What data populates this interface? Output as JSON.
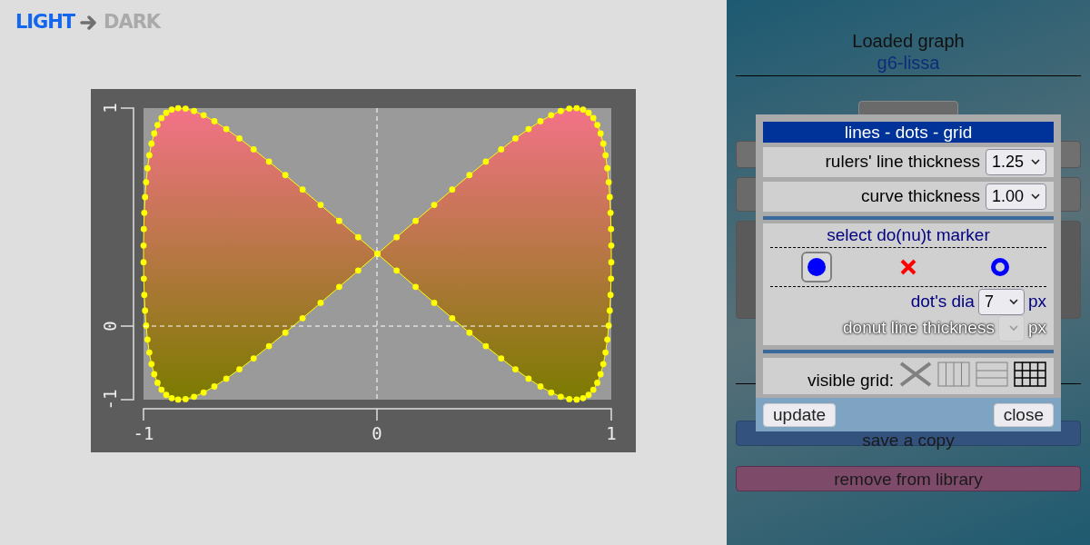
{
  "mode_switch": [
    {
      "label": "LIGHT",
      "selected": true
    },
    {
      "label": "DARK",
      "selected": false
    }
  ],
  "plot": {
    "y_ticks": [
      "1",
      "0",
      "-1"
    ],
    "x_ticks": [
      "-1",
      "0",
      "1"
    ]
  },
  "side_panel": {
    "heading": "Loaded graph",
    "graph_name": "g6-lissa",
    "save_button": "save a copy",
    "remove_button": "remove from library"
  },
  "dialog": {
    "title": "lines - dots - grid",
    "rows": [
      {
        "label": "rulers' line thickness",
        "value": "1.25"
      },
      {
        "label": "curve thickness",
        "value": "1.00"
      }
    ],
    "marker": {
      "title": "select do(nu)t marker",
      "options": [
        {
          "kind": "dot",
          "selected": true
        },
        {
          "kind": "cross",
          "selected": false
        },
        {
          "kind": "donut",
          "selected": false
        }
      ],
      "dia": {
        "label": "dot's dia",
        "value": "7",
        "unit": "px",
        "disabled": false
      },
      "donut_line": {
        "label": "donut line thickness",
        "unit": "px",
        "disabled": true
      }
    },
    "grid": {
      "label": "visible grid:",
      "options": [
        {
          "kind": "none",
          "selected": false
        },
        {
          "kind": "vertical",
          "selected": false
        },
        {
          "kind": "horizontal",
          "selected": false
        },
        {
          "kind": "full",
          "selected": true
        }
      ]
    },
    "buttons": [
      "update",
      "close"
    ]
  }
}
